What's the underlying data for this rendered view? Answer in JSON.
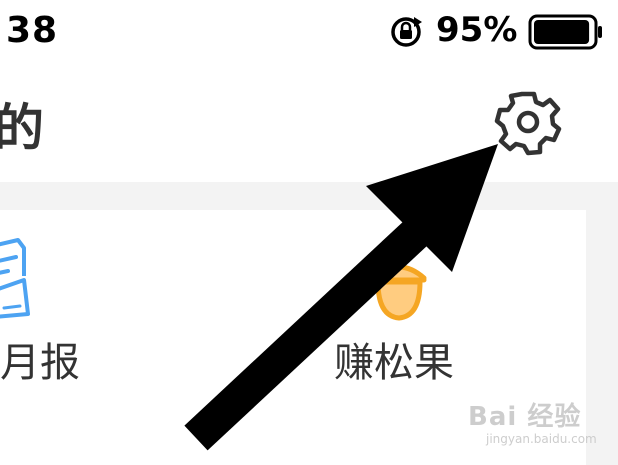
{
  "status_bar": {
    "time": "38",
    "battery_percent": "95%",
    "rotation_lock_icon": "rotation-lock-icon",
    "battery_icon": "battery-icon",
    "battery_level": 0.95
  },
  "header": {
    "title": "的",
    "settings_icon": "gear-icon"
  },
  "card": {
    "items": [
      {
        "label": "月报",
        "icon": "monthly-report-icon"
      },
      {
        "label": "赚松果",
        "icon": "acorn-icon"
      }
    ]
  },
  "overlay": {
    "arrow_icon": "arrow-icon"
  },
  "watermark": {
    "logo": "Bai 经验",
    "url": "jingyan.baidu.com"
  },
  "colors": {
    "text_dark": "#333333",
    "accent_blue": "#4da3f2",
    "accent_orange": "#f5a623",
    "background_gray": "#f3f3f3"
  }
}
